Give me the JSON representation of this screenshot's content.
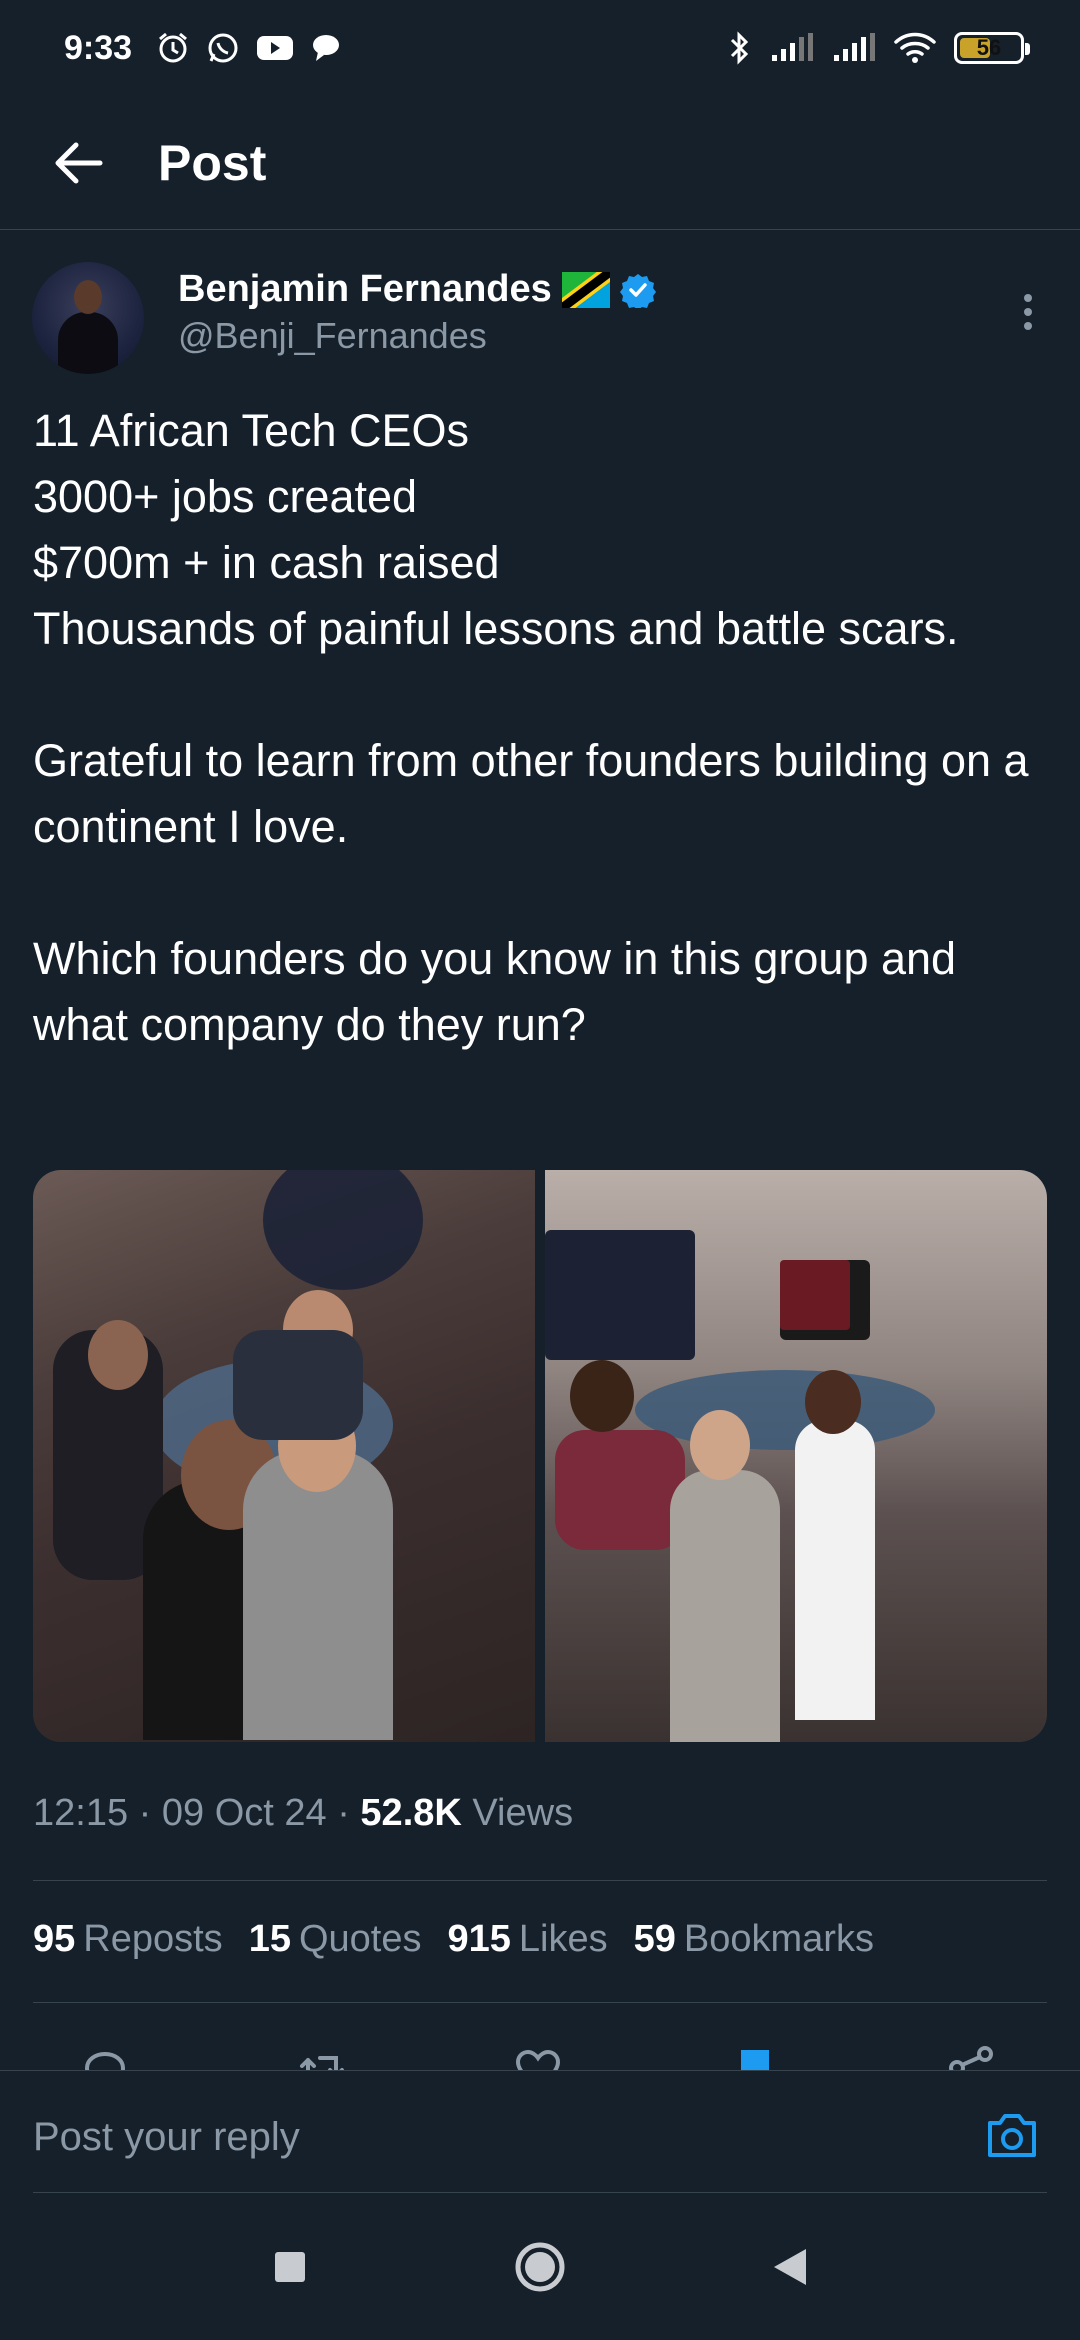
{
  "status_bar": {
    "time": "9:33",
    "battery": "56",
    "battery_fraction": 0.56,
    "icons": [
      "alarm-icon",
      "whatsapp-icon",
      "youtube-icon",
      "chat-icon",
      "bluetooth-icon",
      "signal-icon",
      "signal-icon",
      "wifi-icon",
      "battery-icon"
    ]
  },
  "header": {
    "title": "Post",
    "back_icon": "arrow-left-icon"
  },
  "author": {
    "name": "Benjamin Fernandes",
    "handle": "@Benji_Fernandes",
    "flag_icon": "tanzania-flag-icon",
    "verified_icon": "verified-badge-icon",
    "more_icon": "more-vertical-icon"
  },
  "tweet": {
    "text": "11 African Tech CEOs\n3000+ jobs created\n$700m + in cash raised\nThousands of painful lessons and battle scars.\n\nGrateful to learn from other founders building on a continent I love.\n\nWhich founders do you know in this group and what company do they run?"
  },
  "media": {
    "count": 2
  },
  "meta": {
    "time": "12:15",
    "date": "09 Oct 24",
    "views_count": "52.8K",
    "views_label": "Views",
    "separator": "·"
  },
  "stats": {
    "reposts_count": "95",
    "reposts_label": "Reposts",
    "quotes_count": "15",
    "quotes_label": "Quotes",
    "likes_count": "915",
    "likes_label": "Likes",
    "bookmarks_count": "59",
    "bookmarks_label": "Bookmarks"
  },
  "actions": [
    "reply-icon",
    "repost-icon",
    "like-icon",
    "bookmark-icon",
    "share-icon"
  ],
  "reply": {
    "placeholder": "Post your reply",
    "camera_icon": "camera-icon"
  },
  "colors": {
    "background": "#15202b",
    "accent": "#1d9bf0",
    "secondary_text": "#8b98a5",
    "divider": "#38444d"
  }
}
